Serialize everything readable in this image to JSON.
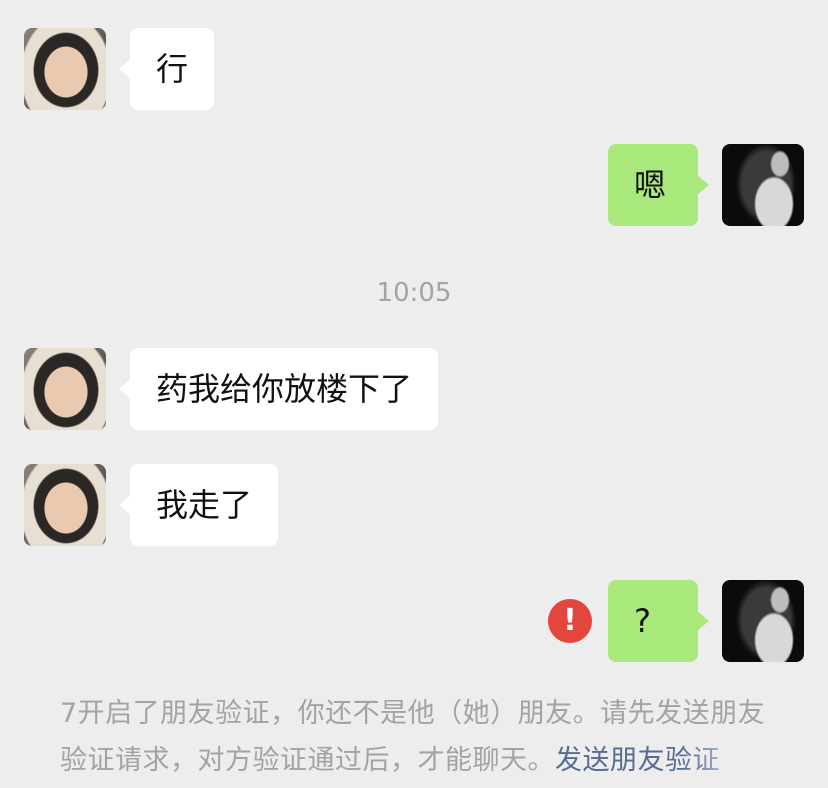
{
  "messages": [
    {
      "side": "incoming",
      "text": "行"
    },
    {
      "side": "outgoing",
      "text": "嗯"
    },
    {
      "side": "incoming",
      "text": "药我给你放楼下了"
    },
    {
      "side": "incoming",
      "text": "我走了"
    },
    {
      "side": "outgoing",
      "text": "?",
      "status": "failed"
    }
  ],
  "timestamp": "10:05",
  "error_icon_glyph": "!",
  "system_note": {
    "text": "7开启了朋友验证，你还不是他（她）朋友。请先发送朋友验证请求，对方验证通过后，才能聊天。",
    "link_text": "发送朋友验证"
  },
  "colors": {
    "background": "#ededed",
    "incoming_bubble": "#ffffff",
    "outgoing_bubble": "#a9e97b",
    "error": "#e2463c",
    "link": "#576b95"
  }
}
